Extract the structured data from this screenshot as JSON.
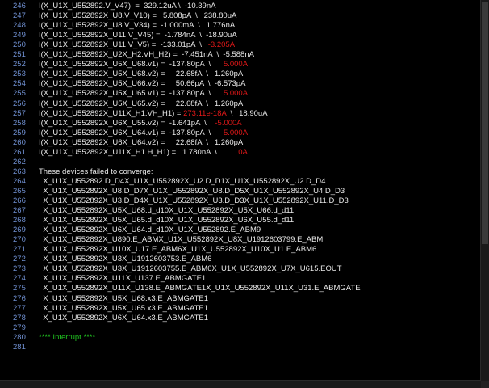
{
  "lines": [
    {
      "n": "246",
      "parts": [
        {
          "t": "I(X_U1X_U552892.V_V47)  =  329.12uA \\  -10.39nA"
        }
      ]
    },
    {
      "n": "247",
      "parts": [
        {
          "t": "I(X_U1X_U552892X_U8.V_V10) =   5.808pA  \\   238.80uA"
        }
      ]
    },
    {
      "n": "248",
      "parts": [
        {
          "t": "I(X_U1X_U552892X_U8.V_V34) =  -1.000mA  \\   1.776nA"
        }
      ]
    },
    {
      "n": "249",
      "parts": [
        {
          "t": "I(X_U1X_U552892X_U11.V_V45) =  -1.784nA  \\  -18.90uA"
        }
      ]
    },
    {
      "n": "250",
      "parts": [
        {
          "t": "I(X_U1X_U552892X_U11.V_V5) =  -133.01pA  \\   "
        },
        {
          "t": "-3.205A",
          "c": "red"
        }
      ]
    },
    {
      "n": "251",
      "parts": [
        {
          "t": "I(X_U1X_U552892X_U2X_H2.VH_H2) =  -7.451nA  \\  -5.588nA"
        }
      ]
    },
    {
      "n": "252",
      "parts": [
        {
          "t": "I(X_U1X_U552892X_U5X_U68.v1) =  -137.80pA  \\      "
        },
        {
          "t": "5.000A",
          "c": "red"
        }
      ]
    },
    {
      "n": "253",
      "parts": [
        {
          "t": "I(X_U1X_U552892X_U5X_U68.v2) =     22.68fA  \\   1.260pA"
        }
      ]
    },
    {
      "n": "254",
      "parts": [
        {
          "t": "I(X_U1X_U552892X_U5X_U66.v2) =     50.66pA  \\  -6.573pA"
        }
      ]
    },
    {
      "n": "255",
      "parts": [
        {
          "t": "I(X_U1X_U552892X_U5X_U65.v1) =  -137.80pA  \\      "
        },
        {
          "t": "5.000A",
          "c": "red"
        }
      ]
    },
    {
      "n": "256",
      "parts": [
        {
          "t": "I(X_U1X_U552892X_U5X_U65.v2) =     22.68fA  \\   1.260pA"
        }
      ]
    },
    {
      "n": "257",
      "parts": [
        {
          "t": "I(X_U1X_U552892X_U11X_H1.VH_H1) = "
        },
        {
          "t": "273.11e-18A",
          "c": "red"
        },
        {
          "t": "  \\   18.90uA"
        }
      ]
    },
    {
      "n": "258",
      "parts": [
        {
          "t": "I(X_U1X_U552892X_U6X_U55.v2) =  -1.641pA  \\    "
        },
        {
          "t": "-5.000A",
          "c": "red"
        }
      ]
    },
    {
      "n": "259",
      "parts": [
        {
          "t": "I(X_U1X_U552892X_U6X_U64.v1) =  -137.80pA  \\      "
        },
        {
          "t": "5.000A",
          "c": "red"
        }
      ]
    },
    {
      "n": "260",
      "parts": [
        {
          "t": "I(X_U1X_U552892X_U6X_U64.v2) =     22.68fA  \\   1.260pA"
        }
      ]
    },
    {
      "n": "261",
      "parts": [
        {
          "t": "I(X_U1X_U552892X_U11X_H1.H_H1) =   1.780nA  \\          "
        },
        {
          "t": "0A",
          "c": "red"
        }
      ]
    },
    {
      "n": "262",
      "parts": [
        {
          "t": ""
        }
      ]
    },
    {
      "n": "263",
      "parts": [
        {
          "t": "These devices failed to converge:"
        }
      ]
    },
    {
      "n": "264",
      "parts": [
        {
          "t": "  X_U1X_U552892.D_D4X_U1X_U552892X_U2.D_D1X_U1X_U552892X_U2.D_D4"
        }
      ]
    },
    {
      "n": "265",
      "parts": [
        {
          "t": "  X_U1X_U552892X_U8.D_D7X_U1X_U552892X_U8.D_D5X_U1X_U552892X_U4.D_D3"
        }
      ]
    },
    {
      "n": "266",
      "parts": [
        {
          "t": "  X_U1X_U552892X_U3.D_D4X_U1X_U552892X_U3.D_D3X_U1X_U552892X_U11.D_D3"
        }
      ]
    },
    {
      "n": "267",
      "parts": [
        {
          "t": "  X_U1X_U552892X_U5X_U68.d_d10X_U1X_U552892X_U5X_U66.d_d11"
        }
      ]
    },
    {
      "n": "268",
      "parts": [
        {
          "t": "  X_U1X_U552892X_U5X_U65.d_d10X_U1X_U552892X_U6X_U55.d_d11"
        }
      ]
    },
    {
      "n": "269",
      "parts": [
        {
          "t": "  X_U1X_U552892X_U6X_U64.d_d10X_U1X_U552892.E_ABM9"
        }
      ]
    },
    {
      "n": "270",
      "parts": [
        {
          "t": "  X_U1X_U552892X_U890.E_ABMX_U1X_U552892X_U8X_U1912603799.E_ABM"
        }
      ]
    },
    {
      "n": "271",
      "parts": [
        {
          "t": "  X_U1X_U552892X_U10X_U17.E_ABM6X_U1X_U552892X_U10X_U1.E_ABM6"
        }
      ]
    },
    {
      "n": "272",
      "parts": [
        {
          "t": "  X_U1X_U552892X_U3X_U1912603753.E_ABM6"
        }
      ]
    },
    {
      "n": "273",
      "parts": [
        {
          "t": "  X_U1X_U552892X_U3X_U1912603755.E_ABM6X_U1X_U552892X_U7X_U615.EOUT"
        }
      ]
    },
    {
      "n": "274",
      "parts": [
        {
          "t": "  X_U1X_U552892X_U11X_U137.E_ABMGATE1"
        }
      ]
    },
    {
      "n": "275",
      "parts": [
        {
          "t": "  X_U1X_U552892X_U11X_U138.E_ABMGATE1X_U1X_U552892X_U11X_U31.E_ABMGATE"
        }
      ]
    },
    {
      "n": "276",
      "parts": [
        {
          "t": "  X_U1X_U552892X_U5X_U68.x3.E_ABMGATE1"
        }
      ]
    },
    {
      "n": "277",
      "parts": [
        {
          "t": "  X_U1X_U552892X_U5X_U65.x3.E_ABMGATE1"
        }
      ]
    },
    {
      "n": "278",
      "parts": [
        {
          "t": "  X_U1X_U552892X_U6X_U64.x3.E_ABMGATE1"
        }
      ]
    },
    {
      "n": "279",
      "parts": [
        {
          "t": ""
        }
      ]
    },
    {
      "n": "280",
      "parts": [
        {
          "t": "**** Interrupt ****",
          "c": "green"
        }
      ]
    },
    {
      "n": "281",
      "parts": [
        {
          "t": ""
        }
      ]
    }
  ],
  "colors": {
    "background": "#000000",
    "text": "#e8e8e8",
    "line_numbers": "#6f8fd0",
    "error": "#e01818",
    "interrupt": "#20c020"
  }
}
